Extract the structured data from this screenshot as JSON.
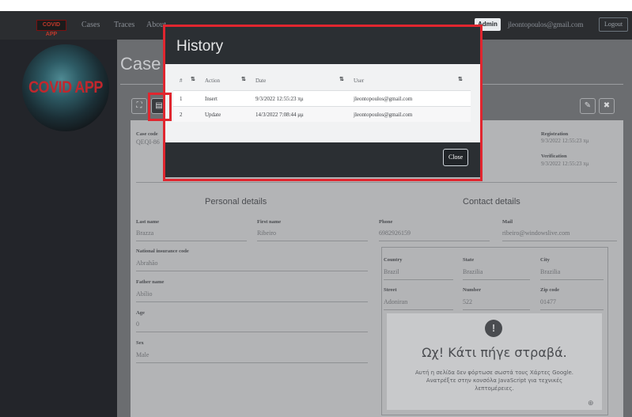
{
  "nav": {
    "brand": "COVID APP",
    "links": [
      "Cases",
      "Traces",
      "About"
    ],
    "admin_badge": "Admin",
    "user_email": "jleontopoulos@gmail.com",
    "logout": "Logout"
  },
  "logo_text": "COVID APP",
  "page_title": "Case D",
  "toolbar": {
    "expand_icon": "⛶",
    "history_icon": "▤",
    "edit_icon": "✎",
    "delete_icon": "✖"
  },
  "case": {
    "code_label": "Case code",
    "code_value": "QEQI-86",
    "registration_label": "Registration",
    "registration_value": "9/3/2022 12:55:23 πμ",
    "verification_label": "Verification",
    "verification_value": "9/3/2022 12:55:23 πμ"
  },
  "personal": {
    "title": "Personal details",
    "last_name_label": "Last name",
    "last_name": "Brazza",
    "first_name_label": "First name",
    "first_name": "Ribeiro",
    "nic_label": "National insurance code",
    "nic": "Abrahão",
    "father_label": "Father name",
    "father": "Abílio",
    "age_label": "Age",
    "age": "0",
    "sex_label": "Sex",
    "sex": "Male"
  },
  "contact": {
    "title": "Contact details",
    "phone_label": "Phone",
    "phone": "6982926159",
    "mail_label": "Mail",
    "mail": "ribeiro@windowslive.com",
    "country_label": "Country",
    "country": "Brazil",
    "state_label": "State",
    "state": "Brazilia",
    "city_label": "City",
    "city": "Brazilia",
    "street_label": "Street",
    "street": "Adoniran",
    "number_label": "Number",
    "number": "522",
    "zip_label": "Zip code",
    "zip": "01477"
  },
  "map_error": {
    "icon": "!",
    "title": "Ωχ! Κάτι πήγε στραβά.",
    "text": "Αυτή η σελίδα δεν φόρτωσε σωστά τους Χάρτες Google. Ανατρέξτε στην κονσόλα JavaScript για τεχνικές λεπτομέρειες.",
    "zoom_icon": "⊕"
  },
  "modal": {
    "title": "History",
    "headers": [
      "#",
      "Action",
      "Date",
      "User"
    ],
    "sort_icon": "⇅",
    "rows": [
      {
        "n": "1",
        "action": "Insert",
        "date": "9/3/2022 12:55:23 πμ",
        "user": "jleontopoulos@gmail.com"
      },
      {
        "n": "2",
        "action": "Update",
        "date": "14/3/2022 7:08:44 μμ",
        "user": "jleontopoulos@gmail.com"
      }
    ],
    "close_label": "Close"
  },
  "colors": {
    "highlight": "#e0262f",
    "modal_bg": "#2b2f33"
  }
}
